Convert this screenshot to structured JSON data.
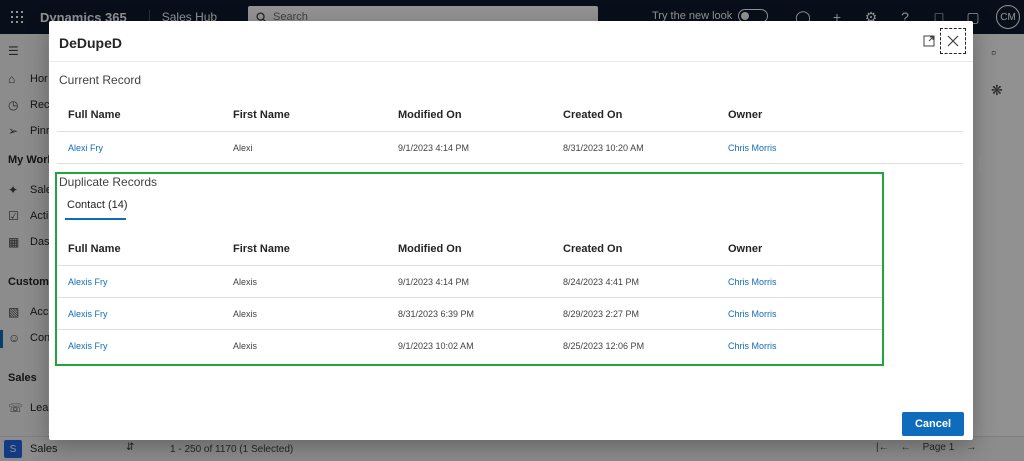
{
  "app": {
    "brand": "Dynamics 365",
    "app_name": "Sales Hub",
    "search_placeholder": "Search",
    "try_new_look": "Try the new look",
    "user_initials": "CM"
  },
  "sidebar": {
    "items_top": [
      {
        "label": "Hor",
        "icon": "home-icon"
      },
      {
        "label": "Rec",
        "icon": "clock-icon"
      },
      {
        "label": "Pinr",
        "icon": "pin-icon"
      }
    ],
    "group1": "My Worl",
    "items_work": [
      {
        "label": "Sale",
        "icon": "rocket-icon"
      },
      {
        "label": "Acti",
        "icon": "checklist-icon"
      },
      {
        "label": "Das",
        "icon": "dashboard-icon"
      }
    ],
    "group2": "Custome",
    "items_cust": [
      {
        "label": "Acc",
        "icon": "building-icon"
      },
      {
        "label": "Con",
        "icon": "person-icon"
      }
    ],
    "group3": "Sales",
    "items_sales": [
      {
        "label": "Lea",
        "icon": "phone-icon"
      }
    ]
  },
  "bottom": {
    "area_badge": "S",
    "area_name": "Sales",
    "record_count": "1 - 250 of 1170 (1 Selected)",
    "page_label": "Page 1"
  },
  "dialog": {
    "title": "DeDupeD",
    "current_section": "Current Record",
    "duplicate_section": "Duplicate Records",
    "tab_label": "Contact (14)",
    "cancel_label": "Cancel",
    "columns": [
      "Full Name",
      "First Name",
      "Modified On",
      "Created On",
      "Owner"
    ],
    "current_rows": [
      {
        "full_name": "Alexi Fry",
        "first_name": "Alexi",
        "modified_on": "9/1/2023 4:14 PM",
        "created_on": "8/31/2023 10:20 AM",
        "owner": "Chris Morris"
      }
    ],
    "duplicate_rows": [
      {
        "full_name": "Alexis Fry",
        "first_name": "Alexis",
        "modified_on": "9/1/2023 4:14 PM",
        "created_on": "8/24/2023 4:41 PM",
        "owner": "Chris Morris"
      },
      {
        "full_name": "Alexis Fry",
        "first_name": "Alexis",
        "modified_on": "8/31/2023 6:39 PM",
        "created_on": "8/29/2023 2:27 PM",
        "owner": "Chris Morris"
      },
      {
        "full_name": "Alexis Fry",
        "first_name": "Alexis",
        "modified_on": "9/1/2023 10:02 AM",
        "created_on": "8/25/2023 12:06 PM",
        "owner": "Chris Morris"
      }
    ]
  },
  "colors": {
    "accent": "#0f6cbd",
    "highlight_box": "#20a63b",
    "topbar": "#0f1a2e"
  }
}
